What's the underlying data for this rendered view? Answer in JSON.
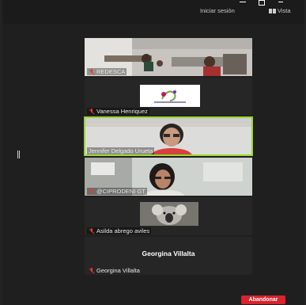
{
  "topbar": {
    "signin_label": "Iniciar sesión",
    "view_label": "Vista",
    "view_icon": "grid-view-icon"
  },
  "participants": [
    {
      "name": "REDESCA",
      "muted": true,
      "video": "room-photo"
    },
    {
      "name": "Vanessa Henriquez",
      "muted": true,
      "video": "logo"
    },
    {
      "name": "Jennifer Delgado Urueta",
      "muted": false,
      "active_speaker": true,
      "video": "person"
    },
    {
      "name": "@CIPRODENI GT",
      "muted": true,
      "video": "person"
    },
    {
      "name": "Asilda abrego aviles",
      "muted": true,
      "video": "koala-photo"
    },
    {
      "name": "Georgina Villalta",
      "muted": true,
      "video": "none",
      "center_label": "Georgina Villalta"
    }
  ],
  "footer": {
    "leave_label": "Abandonar"
  },
  "colors": {
    "active_border": "#9ad62e",
    "leave_button": "#d9232d",
    "muted_icon": "#e53935"
  }
}
